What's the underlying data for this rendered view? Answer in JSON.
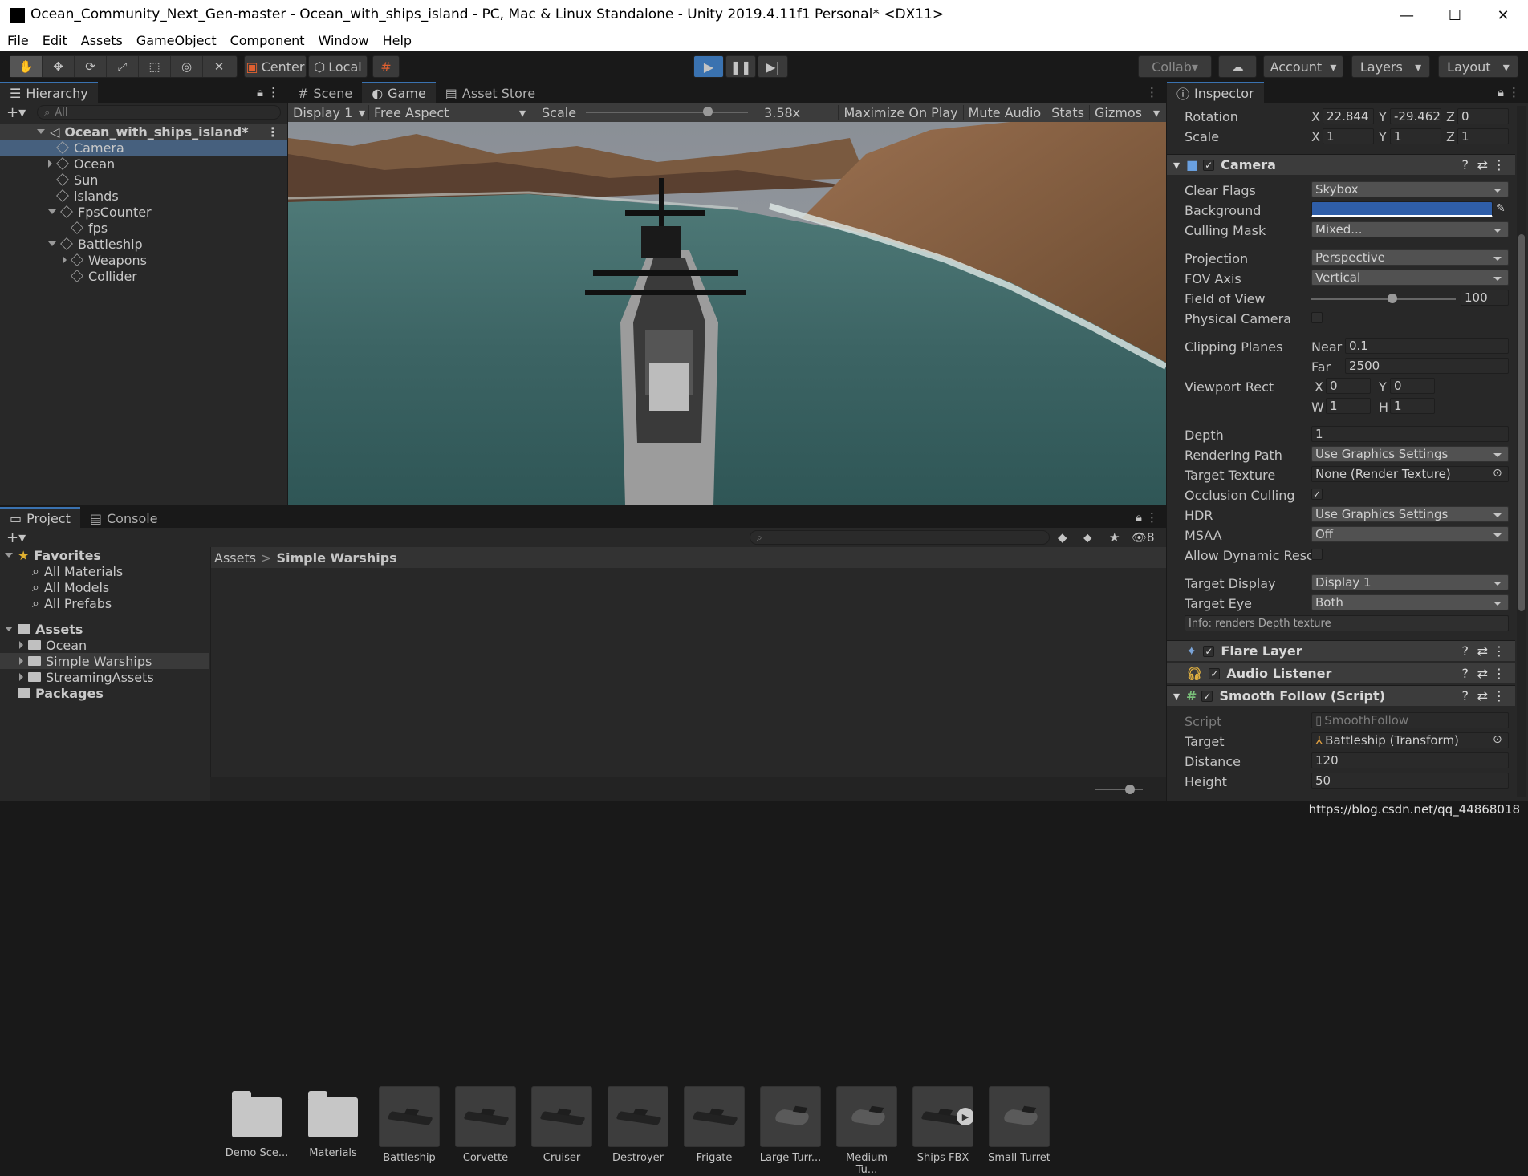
{
  "window": {
    "title": "Ocean_Community_Next_Gen-master - Ocean_with_ships_island - PC, Mac & Linux Standalone - Unity 2019.4.11f1 Personal* <DX11>",
    "minimize": "—",
    "maximize": "☐",
    "close": "✕"
  },
  "menu": [
    "File",
    "Edit",
    "Assets",
    "GameObject",
    "Component",
    "Window",
    "Help"
  ],
  "toolbar": {
    "pivot": "Center",
    "space": "Local",
    "collab": "Collab",
    "account": "Account",
    "layers": "Layers",
    "layout": "Layout"
  },
  "hierarchy": {
    "tab": "Hierarchy",
    "search_placeholder": "All",
    "scene": "Ocean_with_ships_island*",
    "items": [
      {
        "label": "Camera",
        "indent": 1,
        "arrow": "",
        "selected": true
      },
      {
        "label": "Ocean",
        "indent": 1,
        "arrow": "right"
      },
      {
        "label": "Sun",
        "indent": 1,
        "arrow": ""
      },
      {
        "label": "islands",
        "indent": 1,
        "arrow": ""
      },
      {
        "label": "FpsCounter",
        "indent": 1,
        "arrow": "down"
      },
      {
        "label": "fps",
        "indent": 2,
        "arrow": ""
      },
      {
        "label": "Battleship",
        "indent": 1,
        "arrow": "down"
      },
      {
        "label": "Weapons",
        "indent": 2,
        "arrow": "right"
      },
      {
        "label": "Collider",
        "indent": 2,
        "arrow": ""
      }
    ]
  },
  "game": {
    "tabs": [
      "Scene",
      "Game",
      "Asset Store"
    ],
    "display": "Display 1",
    "aspect": "Free Aspect",
    "scale_label": "Scale",
    "scale_value": "3.58x",
    "scale_fraction": 0.75,
    "maximize": "Maximize On Play",
    "mute": "Mute Audio",
    "stats": "Stats",
    "gizmos": "Gizmos"
  },
  "inspector": {
    "tab": "Inspector",
    "rotation": {
      "label": "Rotation",
      "x": "22.844",
      "y": "-29.462",
      "z": "0"
    },
    "scale": {
      "label": "Scale",
      "x": "1",
      "y": "1",
      "z": "1"
    },
    "camera": {
      "title": "Camera",
      "clear_flags": {
        "label": "Clear Flags",
        "value": "Skybox"
      },
      "background": {
        "label": "Background",
        "color": "#2f5ea8"
      },
      "culling_mask": {
        "label": "Culling Mask",
        "value": "Mixed..."
      },
      "projection": {
        "label": "Projection",
        "value": "Perspective"
      },
      "fov_axis": {
        "label": "FOV Axis",
        "value": "Vertical"
      },
      "fov": {
        "label": "Field of View",
        "value": "100",
        "fraction": 0.56
      },
      "physical": {
        "label": "Physical Camera"
      },
      "clipping": {
        "label": "Clipping Planes",
        "near_label": "Near",
        "near": "0.1",
        "far_label": "Far",
        "far": "2500"
      },
      "viewport": {
        "label": "Viewport Rect",
        "x": "0",
        "y": "0",
        "w": "1",
        "h": "1"
      },
      "depth": {
        "label": "Depth",
        "value": "1"
      },
      "rendering_path": {
        "label": "Rendering Path",
        "value": "Use Graphics Settings"
      },
      "target_texture": {
        "label": "Target Texture",
        "value": "None (Render Texture)"
      },
      "occlusion": {
        "label": "Occlusion Culling",
        "check": "✓"
      },
      "hdr": {
        "label": "HDR",
        "value": "Use Graphics Settings"
      },
      "msaa": {
        "label": "MSAA",
        "value": "Off"
      },
      "dynamic_res": {
        "label": "Allow Dynamic Resol"
      },
      "target_display": {
        "label": "Target Display",
        "value": "Display 1"
      },
      "target_eye": {
        "label": "Target Eye",
        "value": "Both"
      },
      "info": "Info: renders Depth texture"
    },
    "flare_layer": "Flare Layer",
    "audio_listener": "Audio Listener",
    "smooth_follow": {
      "title": "Smooth Follow (Script)",
      "script": {
        "label": "Script",
        "value": "SmoothFollow"
      },
      "target": {
        "label": "Target",
        "value": "Battleship (Transform)"
      },
      "distance": {
        "label": "Distance",
        "value": "120"
      },
      "height": {
        "label": "Height",
        "value": "50"
      }
    },
    "check": "✓",
    "help_icon": "?"
  },
  "project": {
    "tabs": [
      "Project",
      "Console"
    ],
    "favorites": "Favorites",
    "fav_items": [
      "All Materials",
      "All Models",
      "All Prefabs"
    ],
    "assets_root": "Assets",
    "asset_folders": [
      "Ocean",
      "Simple Warships",
      "StreamingAssets"
    ],
    "packages": "Packages",
    "breadcrumb_root": "Assets",
    "breadcrumb_sep": ">",
    "breadcrumb_current": "Simple Warships",
    "hidden_count": "8",
    "assets": [
      {
        "name": "Demo Sce...",
        "kind": "folder"
      },
      {
        "name": "Materials",
        "kind": "folder"
      },
      {
        "name": "Battleship",
        "kind": "ship"
      },
      {
        "name": "Corvette",
        "kind": "ship"
      },
      {
        "name": "Cruiser",
        "kind": "ship"
      },
      {
        "name": "Destroyer",
        "kind": "ship"
      },
      {
        "name": "Frigate",
        "kind": "ship"
      },
      {
        "name": "Large Turr...",
        "kind": "turret"
      },
      {
        "name": "Medium Tu...",
        "kind": "turret"
      },
      {
        "name": "Ships FBX",
        "kind": "fbx"
      },
      {
        "name": "Small Turret",
        "kind": "turret"
      }
    ]
  },
  "watermark": "https://blog.csdn.net/qq_44868018"
}
